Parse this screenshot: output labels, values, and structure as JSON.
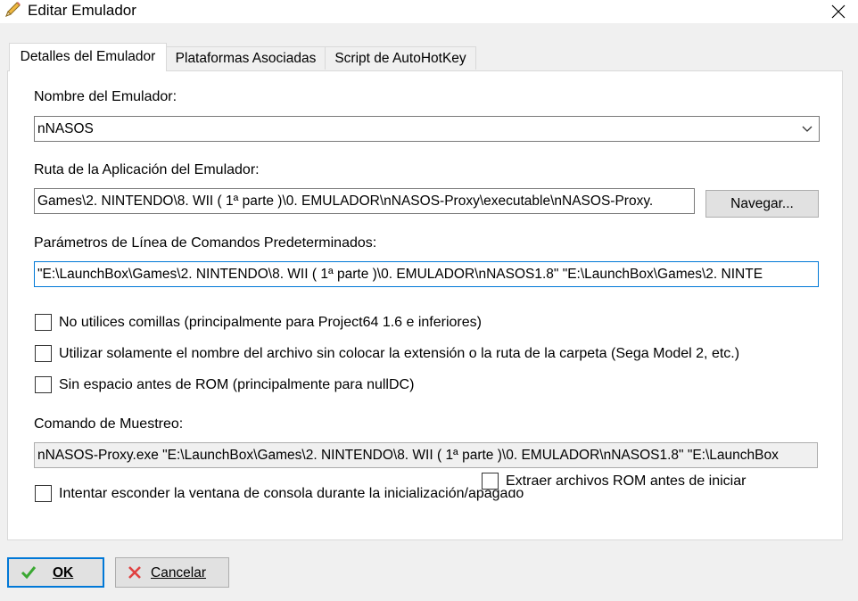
{
  "window": {
    "title": "Editar Emulador",
    "icon": "pencil-icon",
    "close_icon": "close-icon"
  },
  "tabs": [
    {
      "label": "Detalles del Emulador",
      "active": true
    },
    {
      "label": "Plataformas Asociadas",
      "active": false
    },
    {
      "label": "Script de AutoHotKey",
      "active": false
    }
  ],
  "form": {
    "name_label": "Nombre del Emulador:",
    "name_value": "nNASOS",
    "path_label": "Ruta de la Aplicación del Emulador:",
    "path_value": "Games\\2. NINTENDO\\8. WII ( 1ª parte )\\0. EMULADOR\\nNASOS-Proxy\\executable\\nNASOS-Proxy.",
    "browse_label": "Navegar...",
    "params_label": "Parámetros de Línea de Comandos Predeterminados:",
    "params_value": "\"E:\\LaunchBox\\Games\\2. NINTENDO\\8. WII ( 1ª parte )\\0. EMULADOR\\nNASOS1.8\" \"E:\\LaunchBox\\Games\\2. NINTE",
    "checkbox_no_quotes": "No utilices comillas (principalmente para Project64 1.6 e inferiores)",
    "checkbox_filename_only": "Utilizar solamente el nombre del archivo sin colocar la extensión o la ruta de la carpeta  (Sega Model 2, etc.)",
    "checkbox_no_space": "Sin espacio antes de ROM (principalmente para nullDC)",
    "sample_label": "Comando de Muestreo:",
    "sample_value": "nNASOS-Proxy.exe \"E:\\LaunchBox\\Games\\2. NINTENDO\\8. WII ( 1ª parte )\\0. EMULADOR\\nNASOS1.8\" \"E:\\LaunchBox",
    "checkbox_hide_console": "Intentar esconder la ventana de consola durante la inicialización/apagado",
    "checkbox_extract_roms": "Extraer archivos ROM antes de iniciar"
  },
  "buttons": {
    "ok_label": "OK",
    "cancel_label": "Cancelar"
  },
  "colors": {
    "accent": "#0078d7",
    "ok_check": "#3aa832",
    "cancel_x": "#e04040"
  }
}
